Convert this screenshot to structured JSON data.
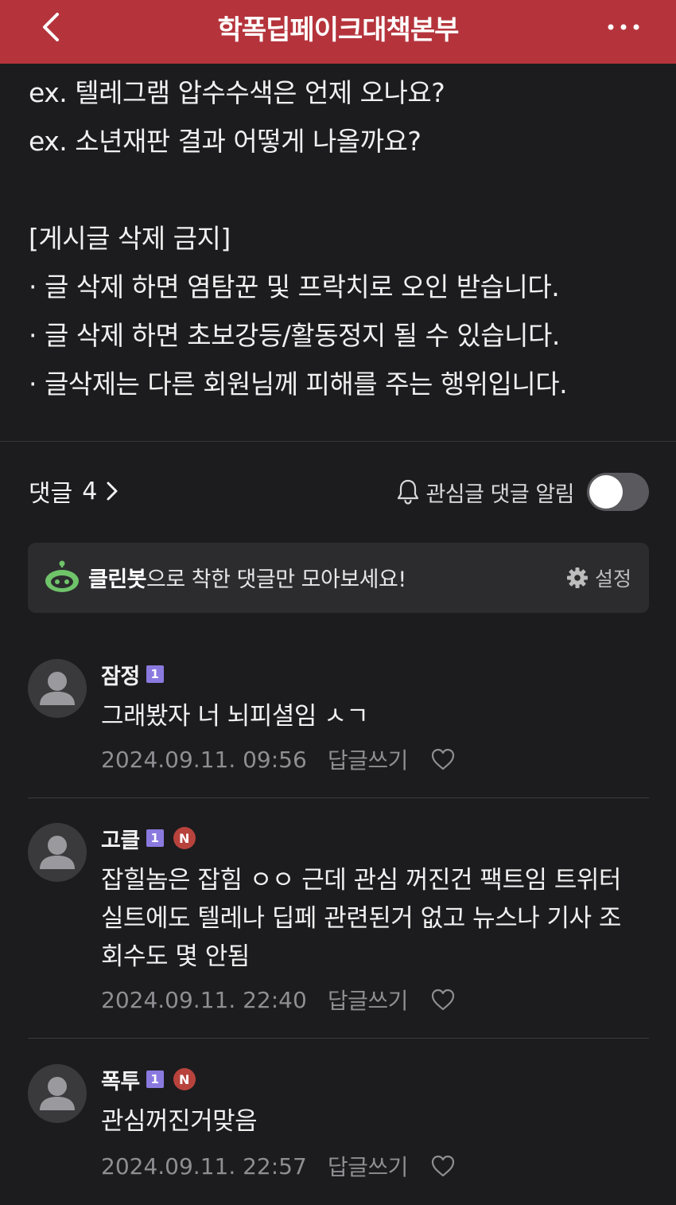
{
  "header": {
    "title": "학폭딥페이크대책본부"
  },
  "post": {
    "lines": [
      "ex. 텔레그램 압수수색은 언제 오나요?",
      "ex. 소년재판 결과 어떻게 나올까요?",
      "",
      "[게시글 삭제 금지]",
      "· 글 삭제 하면 염탐꾼 및 프락치로 오인 받습니다.",
      "· 글 삭제 하면 초보강등/활동정지 될 수 있습니다.",
      "· 글삭제는 다른 회원님께 피해를 주는 행위입니다."
    ]
  },
  "comments_header": {
    "label": "댓글",
    "count": "4",
    "notify_label": "관심글 댓글 알림",
    "notify_on": false
  },
  "cleanbot": {
    "brand": "클린봇",
    "message": "으로 착한 댓글만 모아보세요!",
    "settings_label": "설정"
  },
  "comments": [
    {
      "name": "잠정",
      "level": "1",
      "new_badge": "",
      "text": "그래봤자 너 뇌피셜임 ㅅㄱ",
      "date": "2024.09.11. 09:56",
      "reply_label": "답글쓰기"
    },
    {
      "name": "고클",
      "level": "1",
      "new_badge": "N",
      "text": "잡힐놈은 잡힘 ㅇㅇ 근데 관심 꺼진건 팩트임 트위터 실트에도 텔레나 딥페 관련된거 없고 뉴스나 기사 조회수도 몇 안됨",
      "date": "2024.09.11. 22:40",
      "reply_label": "답글쓰기"
    },
    {
      "name": "폭투",
      "level": "1",
      "new_badge": "N",
      "text": "관심꺼진거맞음",
      "date": "2024.09.11. 22:57",
      "reply_label": "답글쓰기"
    }
  ],
  "colors": {
    "header_bg": "#b5343c",
    "page_bg": "#1c1c1e",
    "level_badge": "#8a7ae0",
    "new_badge": "#b8433d",
    "cleanbot_green": "#6fc46a"
  }
}
